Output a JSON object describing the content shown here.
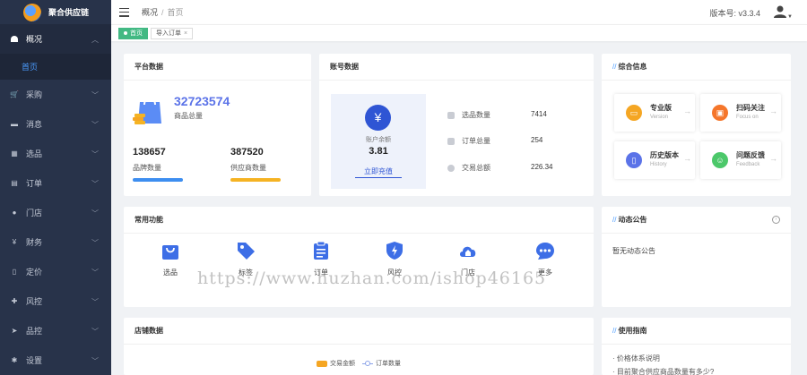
{
  "app": {
    "name": "聚合供应链"
  },
  "sidebar": {
    "items": [
      {
        "label": "概况",
        "icon": "dashboard-icon",
        "open": true
      },
      {
        "label": "采购",
        "icon": "cart-icon"
      },
      {
        "label": "消息",
        "icon": "message-icon"
      },
      {
        "label": "选品",
        "icon": "grid-icon"
      },
      {
        "label": "订单",
        "icon": "order-icon"
      },
      {
        "label": "门店",
        "icon": "store-icon"
      },
      {
        "label": "财务",
        "icon": "yen-icon"
      },
      {
        "label": "定价",
        "icon": "price-icon"
      },
      {
        "label": "风控",
        "icon": "risk-icon"
      },
      {
        "label": "品控",
        "icon": "send-icon"
      },
      {
        "label": "设置",
        "icon": "settings-icon"
      }
    ],
    "sub_item": "首页"
  },
  "header": {
    "breadcrumb": [
      "概况",
      "首页"
    ],
    "version_label": "版本号: v3.3.4"
  },
  "tags": [
    {
      "label": "首页",
      "active": true
    },
    {
      "label": "导入订单",
      "close": "×"
    }
  ],
  "platform": {
    "title": "平台数据",
    "total_goods": "32723574",
    "total_goods_label": "商品总量",
    "brand_count": "138657",
    "brand_label": "品牌数量",
    "supplier_count": "387520",
    "supplier_label": "供应商数量"
  },
  "account": {
    "title": "账号数据",
    "balance_label": "账户余额",
    "balance": "3.81",
    "recharge_label": "立即充值",
    "rows": [
      {
        "label": "选品数量",
        "value": "7414"
      },
      {
        "label": "订单总量",
        "value": "254"
      },
      {
        "label": "交易总额",
        "value": "226.34"
      }
    ]
  },
  "info": {
    "title": "综合信息",
    "tiles": [
      {
        "title": "专业版",
        "sub": "Version",
        "icon": "version-icon",
        "color": "#f5a623"
      },
      {
        "title": "扫码关注",
        "sub": "Focus on",
        "icon": "qrcode-icon",
        "color": "#f5762b"
      },
      {
        "title": "历史版本",
        "sub": "History",
        "icon": "history-icon",
        "color": "#5b73e8"
      },
      {
        "title": "问题反馈",
        "sub": "Feedback",
        "icon": "feedback-icon",
        "color": "#4cc86a"
      }
    ]
  },
  "functions": {
    "title": "常用功能",
    "items": [
      {
        "label": "选品",
        "icon": "bag-icon",
        "glyph": "▇"
      },
      {
        "label": "标签",
        "icon": "tag-icon",
        "glyph": "◆"
      },
      {
        "label": "订单",
        "icon": "clipboard-icon",
        "glyph": "▤"
      },
      {
        "label": "风控",
        "icon": "shield-icon",
        "glyph": "⛨"
      },
      {
        "label": "门店",
        "icon": "home-icon",
        "glyph": "☁"
      },
      {
        "label": "更多",
        "icon": "more-icon",
        "glyph": "●"
      }
    ]
  },
  "notice": {
    "title": "动态公告",
    "empty": "暂无动态公告"
  },
  "shop": {
    "title": "店铺数据",
    "legend_amount": "交易金额",
    "legend_orders": "订单数量"
  },
  "guide": {
    "title": "使用指南",
    "items": [
      "价格体系说明",
      "目前聚合供应商品数量有多少?"
    ]
  },
  "watermark": "https://www.huzhan.com/ishop46165",
  "colors": {
    "sidebar": "#28334a",
    "accent": "#4b9cff",
    "active_tag": "#42b983",
    "balance_circle": "#2f55d4"
  }
}
